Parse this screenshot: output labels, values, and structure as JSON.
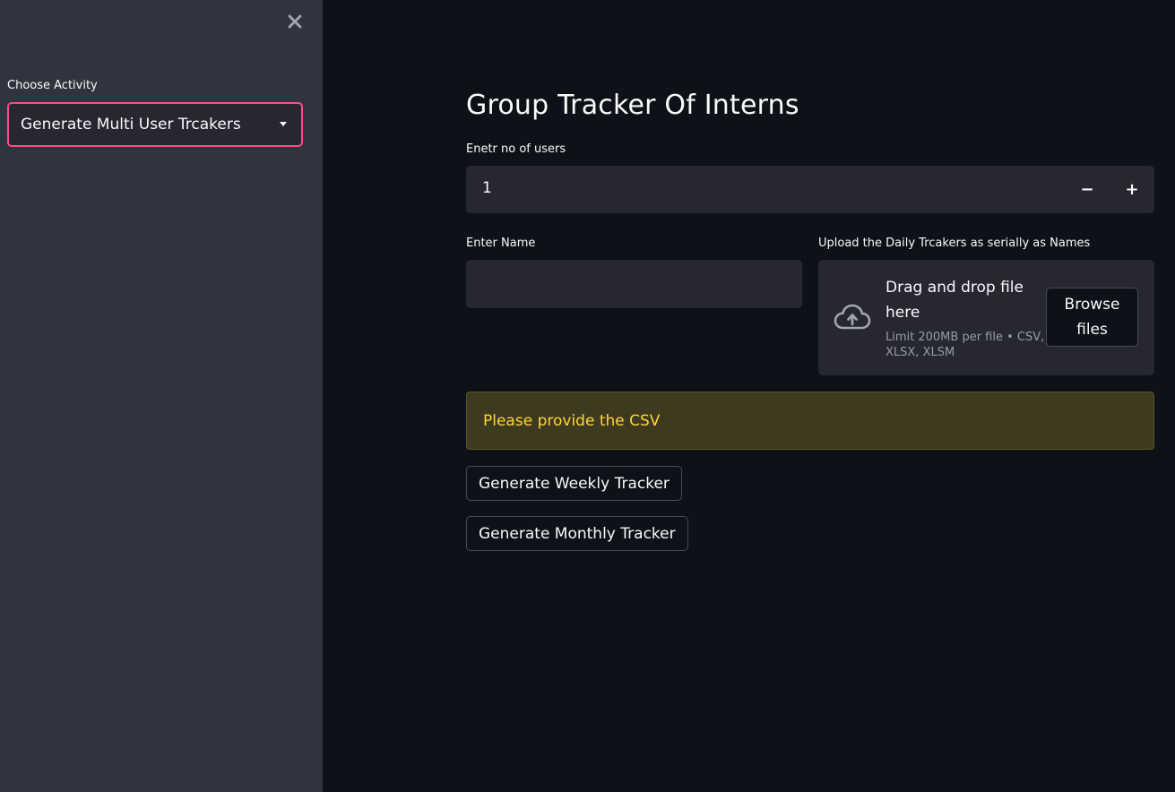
{
  "sidebar": {
    "close_icon": "close-icon",
    "label": "Choose Activity",
    "select_value": "Generate Multi User Trcakers",
    "accent_color": "#ff4b8b"
  },
  "main": {
    "title": "Group Tracker Of Interns",
    "users_field": {
      "label": "Enetr no of users",
      "value": "1",
      "decrement": "−",
      "increment": "+"
    },
    "name_field": {
      "label": "Enter Name",
      "value": ""
    },
    "uploader": {
      "label": "Upload the Daily Trcakers as serially as Names",
      "icon": "cloud-upload-icon",
      "main_text": "Drag and drop file here",
      "sub_text": "Limit 200MB per file • CSV, XLSX, XLSM",
      "button": "Browse files"
    },
    "warning": {
      "text": "Please provide the CSV",
      "color": "#ffd43b"
    },
    "buttons": {
      "weekly": "Generate Weekly Tracker",
      "monthly": "Generate Monthly Tracker"
    }
  }
}
